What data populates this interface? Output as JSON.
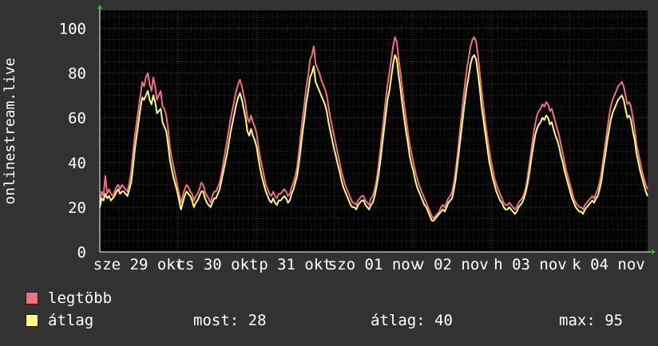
{
  "chart_data": {
    "type": "line",
    "ylabel": "onlinestream.live",
    "ylim": [
      0,
      108
    ],
    "yticks": [
      0,
      20,
      40,
      60,
      80,
      100
    ],
    "x_tick_labels": [
      "sze 29 okt",
      "cs 30 okt",
      "p 31 okt",
      "szo 01 nov",
      "v 02 nov",
      "h 03 nov",
      "k 04 nov"
    ],
    "grid": true,
    "series": [
      {
        "name": "legtöbb",
        "color": "#f2707a",
        "values": [
          22,
          27,
          25,
          34,
          26,
          28,
          26,
          25,
          27,
          29,
          30,
          28,
          30,
          29,
          28,
          27,
          31,
          36,
          45,
          52,
          58,
          64,
          70,
          76,
          74,
          78,
          80,
          75,
          72,
          78,
          74,
          68,
          70,
          72,
          65,
          64,
          61,
          55,
          47,
          42,
          38,
          34,
          30,
          26,
          22,
          25,
          28,
          30,
          29,
          27,
          26,
          23,
          25,
          26,
          28,
          31,
          30,
          27,
          25,
          24,
          22,
          25,
          27,
          27,
          29,
          31,
          35,
          40,
          45,
          50,
          55,
          60,
          64,
          68,
          72,
          75,
          77,
          74,
          70,
          66,
          60,
          58,
          61,
          58,
          56,
          53,
          47,
          42,
          38,
          34,
          30,
          28,
          26,
          25,
          27,
          25,
          24,
          26,
          26,
          27,
          28,
          27,
          25,
          26,
          29,
          31,
          34,
          38,
          45,
          53,
          60,
          67,
          74,
          79,
          86,
          88,
          92,
          84,
          82,
          80,
          77,
          75,
          73,
          70,
          65,
          60,
          56,
          52,
          48,
          44,
          40,
          36,
          33,
          30,
          28,
          26,
          24,
          22,
          22,
          21,
          23,
          24,
          25,
          25,
          23,
          22,
          21,
          24,
          25,
          28,
          32,
          38,
          45,
          53,
          60,
          68,
          75,
          80,
          86,
          92,
          96,
          94,
          86,
          80,
          73,
          66,
          60,
          54,
          48,
          44,
          40,
          36,
          33,
          30,
          28,
          26,
          24,
          22,
          20,
          18,
          16,
          15,
          16,
          17,
          18,
          20,
          21,
          20,
          22,
          24,
          25,
          27,
          31,
          37,
          44,
          52,
          60,
          68,
          75,
          82,
          87,
          92,
          95,
          96,
          94,
          88,
          80,
          72,
          65,
          58,
          52,
          46,
          41,
          37,
          33,
          30,
          28,
          26,
          24,
          22,
          21,
          21,
          22,
          21,
          20,
          19,
          20,
          22,
          23,
          24,
          26,
          29,
          34,
          40,
          46,
          52,
          57,
          61,
          63,
          64,
          66,
          65,
          67,
          66,
          63,
          64,
          61,
          58,
          55,
          52,
          48,
          44,
          40,
          36,
          33,
          30,
          27,
          24,
          22,
          21,
          20,
          20,
          19,
          21,
          22,
          23,
          24,
          25,
          24,
          26,
          28,
          31,
          36,
          42,
          48,
          54,
          60,
          65,
          68,
          70,
          72,
          74,
          75,
          76,
          74,
          70,
          66,
          67,
          65,
          60,
          55,
          48,
          44,
          40,
          36,
          33,
          30,
          28
        ]
      },
      {
        "name": "átlag",
        "color": "#fdfd7a",
        "values": [
          20,
          24,
          23,
          26,
          24,
          25,
          23,
          24,
          25,
          27,
          28,
          26,
          27,
          27,
          26,
          25,
          28,
          31,
          38,
          46,
          52,
          58,
          64,
          69,
          68,
          70,
          72,
          68,
          66,
          70,
          67,
          62,
          63,
          64,
          58,
          56,
          54,
          48,
          41,
          37,
          33,
          30,
          27,
          23,
          19,
          22,
          25,
          27,
          26,
          25,
          23,
          20,
          22,
          23,
          25,
          27,
          27,
          24,
          22,
          21,
          20,
          22,
          24,
          24,
          26,
          28,
          32,
          36,
          40,
          44,
          49,
          54,
          58,
          62,
          66,
          69,
          71,
          68,
          64,
          60,
          54,
          52,
          55,
          52,
          50,
          47,
          42,
          37,
          33,
          30,
          27,
          25,
          23,
          22,
          24,
          22,
          21,
          23,
          23,
          24,
          25,
          24,
          22,
          23,
          26,
          28,
          31,
          34,
          40,
          47,
          54,
          60,
          67,
          72,
          78,
          80,
          83,
          76,
          74,
          72,
          70,
          68,
          66,
          63,
          58,
          54,
          50,
          46,
          43,
          39,
          36,
          32,
          29,
          27,
          25,
          23,
          21,
          20,
          20,
          19,
          21,
          22,
          23,
          23,
          21,
          20,
          19,
          21,
          22,
          25,
          29,
          34,
          40,
          47,
          54,
          61,
          68,
          72,
          78,
          84,
          88,
          86,
          79,
          73,
          66,
          60,
          54,
          49,
          43,
          39,
          36,
          32,
          29,
          27,
          25,
          23,
          21,
          20,
          18,
          16,
          14,
          14,
          15,
          16,
          17,
          18,
          19,
          18,
          20,
          22,
          23,
          24,
          28,
          33,
          40,
          47,
          54,
          61,
          68,
          74,
          79,
          84,
          87,
          88,
          86,
          80,
          73,
          65,
          59,
          53,
          47,
          41,
          37,
          33,
          30,
          27,
          25,
          23,
          22,
          20,
          19,
          19,
          20,
          19,
          18,
          17,
          18,
          20,
          21,
          22,
          24,
          27,
          31,
          36,
          42,
          47,
          52,
          55,
          57,
          58,
          60,
          59,
          61,
          60,
          57,
          58,
          55,
          52,
          50,
          47,
          43,
          40,
          36,
          33,
          30,
          27,
          24,
          22,
          20,
          19,
          18,
          18,
          17,
          19,
          20,
          21,
          22,
          23,
          22,
          24,
          25,
          28,
          32,
          38,
          43,
          49,
          54,
          59,
          62,
          64,
          66,
          68,
          69,
          70,
          68,
          64,
          60,
          61,
          59,
          54,
          50,
          44,
          40,
          36,
          33,
          30,
          27,
          25
        ]
      }
    ]
  },
  "legend": {
    "max_label": "legtöbb",
    "avg_label": "átlag",
    "stats": [
      {
        "label": "most:",
        "value": "28"
      },
      {
        "label": "átlag:",
        "value": "40"
      },
      {
        "label": "max:",
        "value": "95"
      }
    ]
  }
}
